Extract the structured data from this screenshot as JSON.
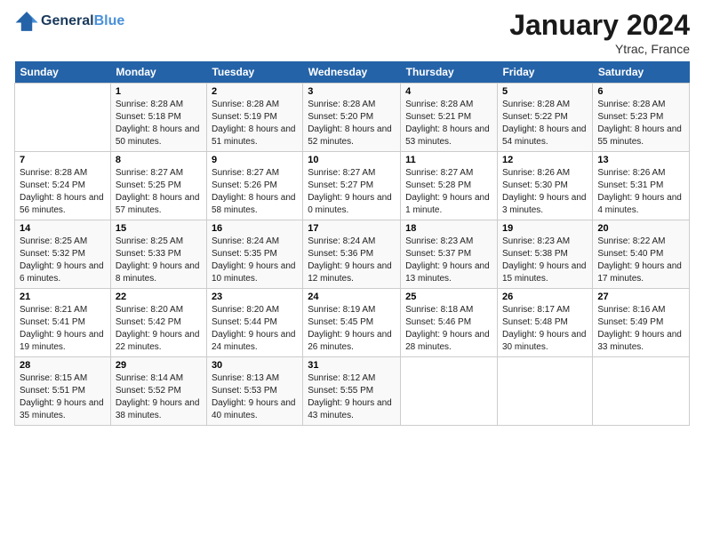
{
  "header": {
    "logo_text_general": "General",
    "logo_text_blue": "Blue",
    "month_title": "January 2024",
    "location": "Ytrac, France"
  },
  "days_of_week": [
    "Sunday",
    "Monday",
    "Tuesday",
    "Wednesday",
    "Thursday",
    "Friday",
    "Saturday"
  ],
  "weeks": [
    [
      {
        "day": "",
        "sunrise": "",
        "sunset": "",
        "daylight": ""
      },
      {
        "day": "1",
        "sunrise": "Sunrise: 8:28 AM",
        "sunset": "Sunset: 5:18 PM",
        "daylight": "Daylight: 8 hours and 50 minutes."
      },
      {
        "day": "2",
        "sunrise": "Sunrise: 8:28 AM",
        "sunset": "Sunset: 5:19 PM",
        "daylight": "Daylight: 8 hours and 51 minutes."
      },
      {
        "day": "3",
        "sunrise": "Sunrise: 8:28 AM",
        "sunset": "Sunset: 5:20 PM",
        "daylight": "Daylight: 8 hours and 52 minutes."
      },
      {
        "day": "4",
        "sunrise": "Sunrise: 8:28 AM",
        "sunset": "Sunset: 5:21 PM",
        "daylight": "Daylight: 8 hours and 53 minutes."
      },
      {
        "day": "5",
        "sunrise": "Sunrise: 8:28 AM",
        "sunset": "Sunset: 5:22 PM",
        "daylight": "Daylight: 8 hours and 54 minutes."
      },
      {
        "day": "6",
        "sunrise": "Sunrise: 8:28 AM",
        "sunset": "Sunset: 5:23 PM",
        "daylight": "Daylight: 8 hours and 55 minutes."
      }
    ],
    [
      {
        "day": "7",
        "sunrise": "Sunrise: 8:28 AM",
        "sunset": "Sunset: 5:24 PM",
        "daylight": "Daylight: 8 hours and 56 minutes."
      },
      {
        "day": "8",
        "sunrise": "Sunrise: 8:27 AM",
        "sunset": "Sunset: 5:25 PM",
        "daylight": "Daylight: 8 hours and 57 minutes."
      },
      {
        "day": "9",
        "sunrise": "Sunrise: 8:27 AM",
        "sunset": "Sunset: 5:26 PM",
        "daylight": "Daylight: 8 hours and 58 minutes."
      },
      {
        "day": "10",
        "sunrise": "Sunrise: 8:27 AM",
        "sunset": "Sunset: 5:27 PM",
        "daylight": "Daylight: 9 hours and 0 minutes."
      },
      {
        "day": "11",
        "sunrise": "Sunrise: 8:27 AM",
        "sunset": "Sunset: 5:28 PM",
        "daylight": "Daylight: 9 hours and 1 minute."
      },
      {
        "day": "12",
        "sunrise": "Sunrise: 8:26 AM",
        "sunset": "Sunset: 5:30 PM",
        "daylight": "Daylight: 9 hours and 3 minutes."
      },
      {
        "day": "13",
        "sunrise": "Sunrise: 8:26 AM",
        "sunset": "Sunset: 5:31 PM",
        "daylight": "Daylight: 9 hours and 4 minutes."
      }
    ],
    [
      {
        "day": "14",
        "sunrise": "Sunrise: 8:25 AM",
        "sunset": "Sunset: 5:32 PM",
        "daylight": "Daylight: 9 hours and 6 minutes."
      },
      {
        "day": "15",
        "sunrise": "Sunrise: 8:25 AM",
        "sunset": "Sunset: 5:33 PM",
        "daylight": "Daylight: 9 hours and 8 minutes."
      },
      {
        "day": "16",
        "sunrise": "Sunrise: 8:24 AM",
        "sunset": "Sunset: 5:35 PM",
        "daylight": "Daylight: 9 hours and 10 minutes."
      },
      {
        "day": "17",
        "sunrise": "Sunrise: 8:24 AM",
        "sunset": "Sunset: 5:36 PM",
        "daylight": "Daylight: 9 hours and 12 minutes."
      },
      {
        "day": "18",
        "sunrise": "Sunrise: 8:23 AM",
        "sunset": "Sunset: 5:37 PM",
        "daylight": "Daylight: 9 hours and 13 minutes."
      },
      {
        "day": "19",
        "sunrise": "Sunrise: 8:23 AM",
        "sunset": "Sunset: 5:38 PM",
        "daylight": "Daylight: 9 hours and 15 minutes."
      },
      {
        "day": "20",
        "sunrise": "Sunrise: 8:22 AM",
        "sunset": "Sunset: 5:40 PM",
        "daylight": "Daylight: 9 hours and 17 minutes."
      }
    ],
    [
      {
        "day": "21",
        "sunrise": "Sunrise: 8:21 AM",
        "sunset": "Sunset: 5:41 PM",
        "daylight": "Daylight: 9 hours and 19 minutes."
      },
      {
        "day": "22",
        "sunrise": "Sunrise: 8:20 AM",
        "sunset": "Sunset: 5:42 PM",
        "daylight": "Daylight: 9 hours and 22 minutes."
      },
      {
        "day": "23",
        "sunrise": "Sunrise: 8:20 AM",
        "sunset": "Sunset: 5:44 PM",
        "daylight": "Daylight: 9 hours and 24 minutes."
      },
      {
        "day": "24",
        "sunrise": "Sunrise: 8:19 AM",
        "sunset": "Sunset: 5:45 PM",
        "daylight": "Daylight: 9 hours and 26 minutes."
      },
      {
        "day": "25",
        "sunrise": "Sunrise: 8:18 AM",
        "sunset": "Sunset: 5:46 PM",
        "daylight": "Daylight: 9 hours and 28 minutes."
      },
      {
        "day": "26",
        "sunrise": "Sunrise: 8:17 AM",
        "sunset": "Sunset: 5:48 PM",
        "daylight": "Daylight: 9 hours and 30 minutes."
      },
      {
        "day": "27",
        "sunrise": "Sunrise: 8:16 AM",
        "sunset": "Sunset: 5:49 PM",
        "daylight": "Daylight: 9 hours and 33 minutes."
      }
    ],
    [
      {
        "day": "28",
        "sunrise": "Sunrise: 8:15 AM",
        "sunset": "Sunset: 5:51 PM",
        "daylight": "Daylight: 9 hours and 35 minutes."
      },
      {
        "day": "29",
        "sunrise": "Sunrise: 8:14 AM",
        "sunset": "Sunset: 5:52 PM",
        "daylight": "Daylight: 9 hours and 38 minutes."
      },
      {
        "day": "30",
        "sunrise": "Sunrise: 8:13 AM",
        "sunset": "Sunset: 5:53 PM",
        "daylight": "Daylight: 9 hours and 40 minutes."
      },
      {
        "day": "31",
        "sunrise": "Sunrise: 8:12 AM",
        "sunset": "Sunset: 5:55 PM",
        "daylight": "Daylight: 9 hours and 43 minutes."
      },
      {
        "day": "",
        "sunrise": "",
        "sunset": "",
        "daylight": ""
      },
      {
        "day": "",
        "sunrise": "",
        "sunset": "",
        "daylight": ""
      },
      {
        "day": "",
        "sunrise": "",
        "sunset": "",
        "daylight": ""
      }
    ]
  ]
}
